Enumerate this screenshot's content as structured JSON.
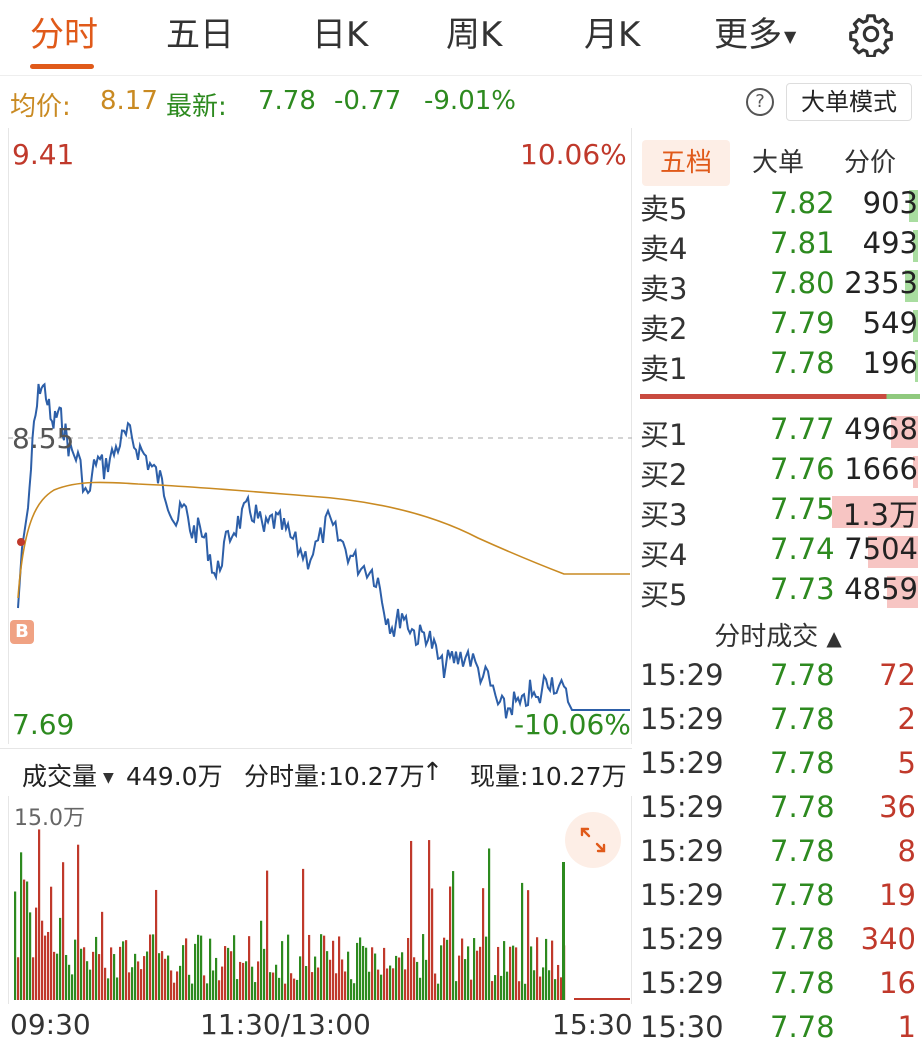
{
  "tabs": [
    {
      "label": "分时",
      "active": true
    },
    {
      "label": "五日"
    },
    {
      "label": "日K"
    },
    {
      "label": "周K"
    },
    {
      "label": "月K"
    },
    {
      "label": "更多"
    }
  ],
  "info": {
    "avg_label": "均价:",
    "avg_value": "8.17",
    "latest_label": "最新:",
    "latest_value": "7.78",
    "change": "-0.77",
    "change_pct": "-9.01%",
    "help": "?",
    "big_order_mode": "大单模式"
  },
  "price_chart": {
    "y_max": "9.41",
    "y_mid": "8.55",
    "y_min": "7.69",
    "pct_max": "10.06%",
    "pct_min": "-10.06%",
    "marker": "B",
    "colors": {
      "price": "#2d5fa8",
      "avg": "#c98a22",
      "up": "#c0392b",
      "down": "#2d8a1f"
    }
  },
  "volume_bar": {
    "volume_label": "成交量",
    "total_volume": "449.0万",
    "minute_volume_label": "分时量:",
    "minute_volume": "10.27万",
    "current_label": "现量:",
    "current_volume": "10.27万",
    "max_label": "15.0万"
  },
  "time_axis": [
    "09:30",
    "11:30/13:00",
    "15:30"
  ],
  "order_book": {
    "tabs": [
      "五档",
      "大单",
      "分价"
    ],
    "asks": [
      {
        "label": "卖5",
        "price": "7.82",
        "volume": "903",
        "bar": 0.1
      },
      {
        "label": "卖4",
        "price": "7.81",
        "volume": "493",
        "bar": 0.05
      },
      {
        "label": "卖3",
        "price": "7.80",
        "volume": "2353",
        "bar": 0.14
      },
      {
        "label": "卖2",
        "price": "7.79",
        "volume": "549",
        "bar": 0.05
      },
      {
        "label": "卖1",
        "price": "7.78",
        "volume": "196",
        "bar": 0.03
      }
    ],
    "bids": [
      {
        "label": "买1",
        "price": "7.77",
        "volume": "4968",
        "bar": 0.3
      },
      {
        "label": "买2",
        "price": "7.76",
        "volume": "1666",
        "bar": 0.05
      },
      {
        "label": "买3",
        "price": "7.75",
        "volume": "1.3万",
        "bar": 0.95
      },
      {
        "label": "买4",
        "price": "7.74",
        "volume": "7504",
        "bar": 0.55
      },
      {
        "label": "买5",
        "price": "7.73",
        "volume": "4859",
        "bar": 0.35
      }
    ]
  },
  "trades": {
    "title": "分时成交",
    "rows": [
      {
        "time": "15:29",
        "price": "7.78",
        "volume": "72",
        "side": "sell"
      },
      {
        "time": "15:29",
        "price": "7.78",
        "volume": "2",
        "side": "sell"
      },
      {
        "time": "15:29",
        "price": "7.78",
        "volume": "5",
        "side": "sell"
      },
      {
        "time": "15:29",
        "price": "7.78",
        "volume": "36",
        "side": "sell"
      },
      {
        "time": "15:29",
        "price": "7.78",
        "volume": "8",
        "side": "sell"
      },
      {
        "time": "15:29",
        "price": "7.78",
        "volume": "19",
        "side": "sell"
      },
      {
        "time": "15:29",
        "price": "7.78",
        "volume": "340",
        "side": "sell"
      },
      {
        "time": "15:29",
        "price": "7.78",
        "volume": "16",
        "side": "sell"
      },
      {
        "time": "15:30",
        "price": "7.78",
        "volume": "1",
        "side": "sell"
      }
    ]
  }
}
